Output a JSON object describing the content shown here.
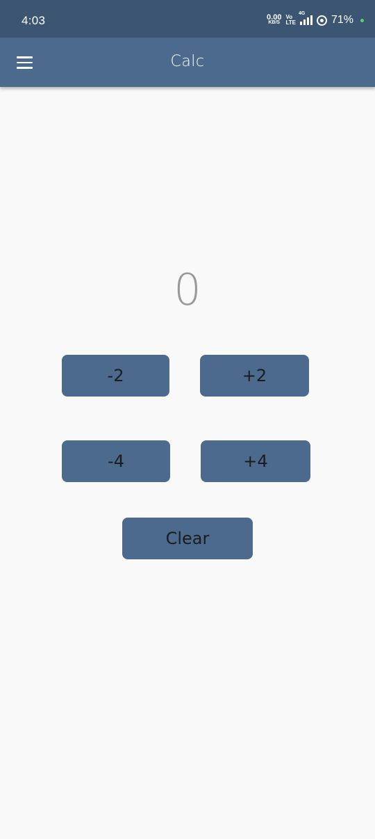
{
  "status_bar": {
    "time": "4:03",
    "net_speed_value": "0.00",
    "net_speed_unit": "KB/S",
    "volte_top": "Vo",
    "volte_bottom": "LTE",
    "network_type": "4G",
    "battery": "71%",
    "icons": [
      "signal-icon",
      "battery-icon",
      "notification-dot-icon"
    ]
  },
  "app_bar": {
    "title": "Calc",
    "menu_icon": "hamburger-menu-icon"
  },
  "display": {
    "value": "0"
  },
  "buttons": {
    "minus2": "-2",
    "plus2": "+2",
    "minus4": "-4",
    "plus4": "+4",
    "clear": "Clear"
  },
  "colors": {
    "status_bar": "#3b5573",
    "app_bar": "#4b6a8d",
    "button": "#4b6a8d",
    "background": "#f9f9f9",
    "display_text": "#999999"
  }
}
